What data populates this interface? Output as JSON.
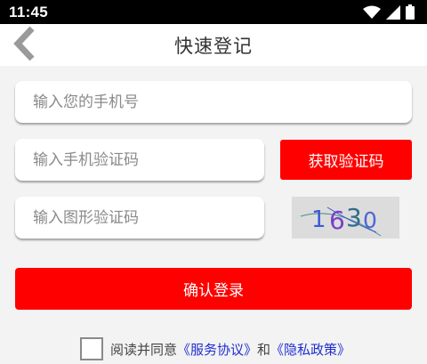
{
  "status_bar": {
    "time": "11:45"
  },
  "app_bar": {
    "title": "快速登记"
  },
  "form": {
    "phone_placeholder": "输入您的手机号",
    "sms_code_placeholder": "输入手机验证码",
    "image_code_placeholder": "输入图形验证码",
    "get_code_label": "获取验证码",
    "captcha_text": [
      "1",
      "6",
      "3",
      "0"
    ],
    "captcha_colors": [
      "#3b5bd6",
      "#7a3fc8",
      "#2f6e8a",
      "#4a68d8"
    ],
    "confirm_label": "确认登录"
  },
  "agreement": {
    "prefix": "阅读并同意",
    "terms_link": "《服务协议》",
    "conjunction": "和",
    "privacy_link": "《隐私政策》"
  },
  "colors": {
    "accent": "#ff0000",
    "link": "#1f2fd0",
    "background": "#f3f3f3"
  }
}
